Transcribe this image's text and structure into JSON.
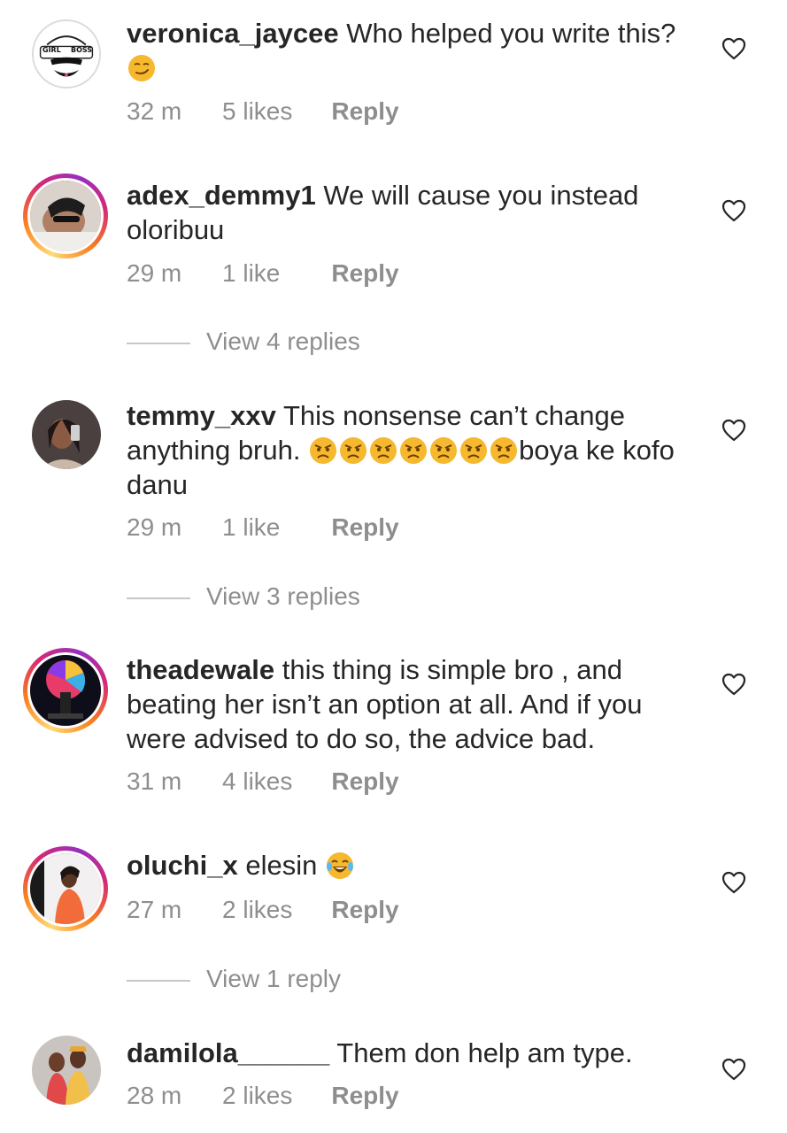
{
  "comments": [
    {
      "username": "veronica_jaycee",
      "text": "Who helped you write this?",
      "time": "32 m",
      "likes": "5 likes",
      "reply": "Reply",
      "avatar_text_left": "GIRL",
      "avatar_text_right": "BOSS"
    },
    {
      "username": "adex_demmy1",
      "text": "We will cause you instead oloribuu",
      "time": "29 m",
      "likes": "1 like",
      "reply": "Reply",
      "view_replies": "View 4 replies"
    },
    {
      "username": "temmy_xxv",
      "text_before": "This nonsense can’t change anything bruh. ",
      "text_after": "boya ke kofo danu",
      "time": "29 m",
      "likes": "1 like",
      "reply": "Reply",
      "view_replies": "View 3 replies"
    },
    {
      "username": "theadewale",
      "text": "this thing is simple bro , and beating her isn’t an option at all. And if you were advised to do so, the advice bad.",
      "time": "31 m",
      "likes": "4 likes",
      "reply": "Reply"
    },
    {
      "username": "oluchi_x",
      "text": "elesin",
      "time": "27 m",
      "likes": "2 likes",
      "reply": "Reply",
      "view_replies": "View 1 reply"
    },
    {
      "username": "damilola______",
      "text": "Them don help am type.",
      "time": "28 m",
      "likes": "2 likes",
      "reply": "Reply"
    }
  ],
  "icons": {
    "like": "heart-outline-icon",
    "smirk": "smirking-face-emoji",
    "angry": "angry-face-emoji",
    "laugh": "tears-of-joy-emoji"
  },
  "colors": {
    "text": "#262626",
    "meta": "#8e8e8e",
    "emoji": "#f5b82e"
  }
}
